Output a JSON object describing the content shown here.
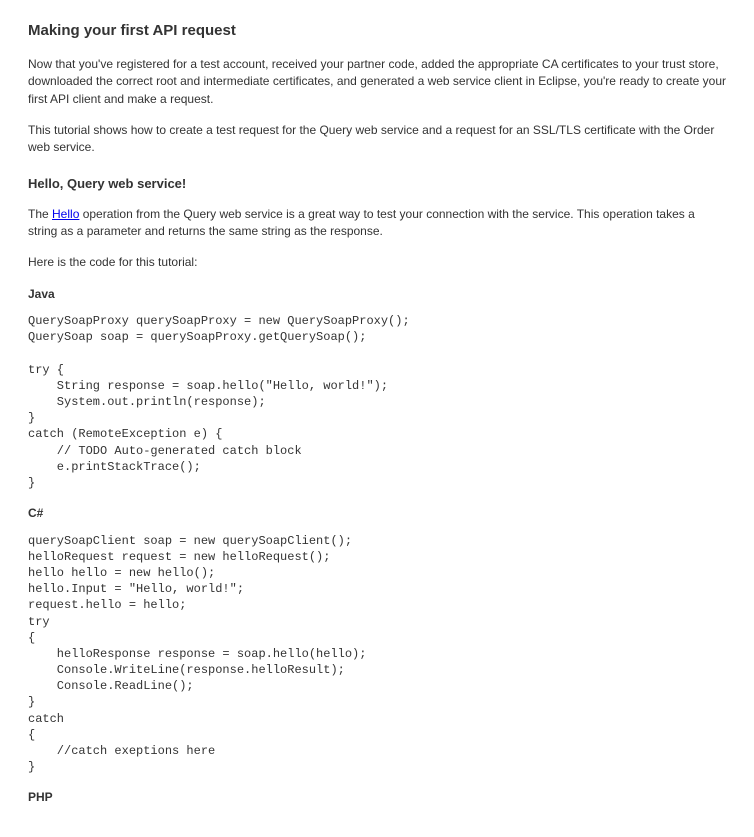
{
  "title": "Making your first API request",
  "intro1": "Now that you've registered for a test account, received your partner code, added the appropriate CA certificates to your trust store, downloaded the correct root and intermediate certificates, and generated a web service client in Eclipse, you're ready to create your first API client and make a request.",
  "intro2": "This tutorial shows how to create a test request for the Query web service and a request for an SSL/TLS certificate with the Order web service.",
  "section1_heading": "Hello, Query web service!",
  "section1_p1_pre": "The ",
  "section1_p1_link": "Hello",
  "section1_p1_post": " operation from the Query web service is a great way to test your connection with the service. This operation takes a string as a parameter and returns the same string as the response.",
  "section1_p2": "Here is the code for this tutorial:",
  "java_heading": "Java",
  "java_code": "QuerySoapProxy querySoapProxy = new QuerySoapProxy();\nQuerySoap soap = querySoapProxy.getQuerySoap();\n\ntry {\n    String response = soap.hello(\"Hello, world!\");\n    System.out.println(response);\n}\ncatch (RemoteException e) {\n    // TODO Auto-generated catch block\n    e.printStackTrace();\n}",
  "csharp_heading": "C#",
  "csharp_code": "querySoapClient soap = new querySoapClient();\nhelloRequest request = new helloRequest();\nhello hello = new hello();\nhello.Input = \"Hello, world!\";\nrequest.hello = hello;\ntry\n{\n    helloResponse response = soap.hello(hello);\n    Console.WriteLine(response.helloResult);\n    Console.ReadLine();\n}\ncatch\n{\n    //catch exeptions here\n}",
  "php_heading": "PHP"
}
